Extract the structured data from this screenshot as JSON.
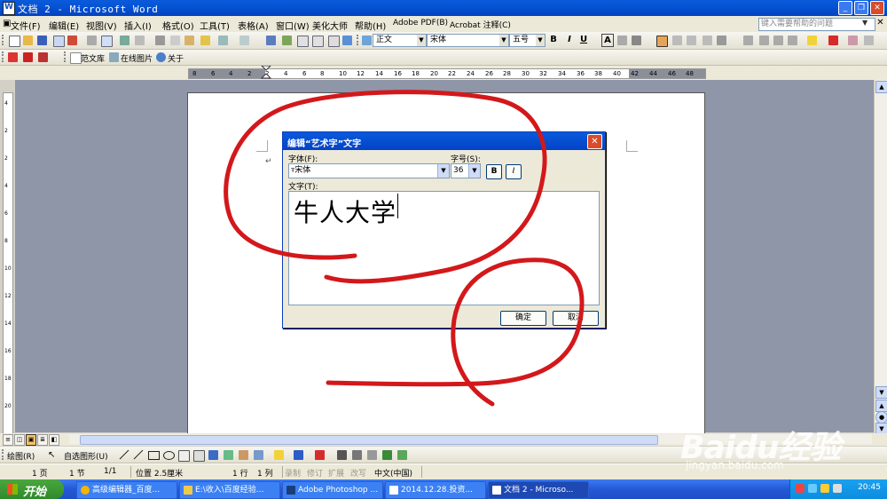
{
  "window": {
    "title": "文档 2 - Microsoft Word"
  },
  "menu": {
    "items": [
      "文件(F)",
      "编辑(E)",
      "视图(V)",
      "插入(I)",
      "格式(O)",
      "工具(T)",
      "表格(A)",
      "窗口(W)",
      "美化大师",
      "帮助(H)",
      "Adobe PDF(B)",
      "Acrobat 注释(C)"
    ],
    "help_placeholder": "键入需要帮助的问题"
  },
  "toolbar": {
    "style_value": "正文",
    "font_value": "宋体",
    "size_value": "五号",
    "bold": "B",
    "italic": "I",
    "underline": "U",
    "char_shade": "A"
  },
  "toolbar2": {
    "fanwenku": "范文库",
    "online_image": "在线图片",
    "about": "关于"
  },
  "ruler": {
    "h_ticks": [
      "8",
      "6",
      "4",
      "2",
      "2",
      "4",
      "6",
      "8",
      "10",
      "12",
      "14",
      "16",
      "18",
      "20",
      "22",
      "24",
      "26",
      "28",
      "30",
      "32",
      "34",
      "36",
      "38",
      "40",
      "42",
      "44",
      "46",
      "48"
    ],
    "v_ticks": [
      "4",
      "2",
      "2",
      "4",
      "6",
      "8",
      "10",
      "12",
      "14",
      "16",
      "18",
      "20"
    ]
  },
  "dialog": {
    "title": "编辑“艺术字”文字",
    "font_label": "字体(F):",
    "font_value": "宋体",
    "size_label": "字号(S):",
    "size_value": "36",
    "bold": "B",
    "italic": "I",
    "text_label": "文字(T):",
    "text_value": "牛人大学",
    "ok": "确定",
    "cancel": "取消"
  },
  "drawbar": {
    "draw": "绘图(R)",
    "autoshapes": "自选图形(U)"
  },
  "status": {
    "page": "1 页",
    "section": "1 节",
    "pages": "1/1",
    "position": "位置 2.5厘米",
    "line": "1 行",
    "column": "1 列",
    "rec": "录制",
    "trk": "修订",
    "ext": "扩展",
    "ovr": "改写",
    "lang": "中文(中国)"
  },
  "taskbar": {
    "start": "开始",
    "tasks": [
      "高级编辑器_百度...",
      "E:\\收入\\百度经验...",
      "Adobe Photoshop ...",
      "2014.12.28.投资...",
      "文档 2 - Microso..."
    ],
    "clock": "20:45"
  },
  "watermark": {
    "logo": "Baidu经验",
    "url": "jingyan.baidu.com"
  },
  "colors": {
    "title_blue": "#0554d4",
    "annotation_red": "#d3181b",
    "doc_bg": "#8f96a8"
  }
}
